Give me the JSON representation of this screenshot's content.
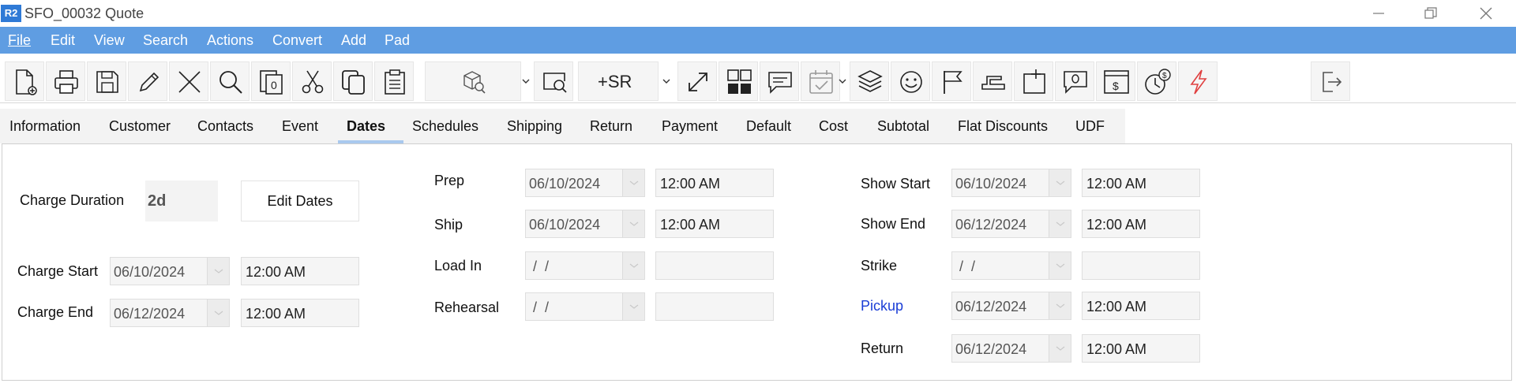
{
  "window": {
    "logo": "R2",
    "title": "SFO_00032 Quote"
  },
  "menu": [
    "File",
    "Edit",
    "View",
    "Search",
    "Actions",
    "Convert",
    "Add",
    "Pad"
  ],
  "toolbar": {
    "sr_label": "+SR",
    "icons": [
      "new-document-icon",
      "print-icon",
      "save-icon",
      "edit-pencil-icon",
      "delete-x-icon",
      "search-icon",
      "copy-number-icon",
      "cut-icon",
      "duplicate-icon",
      "paste-icon",
      "box-search-icon",
      "screen-search-icon",
      "expand-icon",
      "grid-icon",
      "comment-icon",
      "calendar-check-icon",
      "layers-icon",
      "smiley-icon",
      "flag-icon",
      "stapler-icon",
      "note-insert-icon",
      "message-icon",
      "invoice-icon",
      "time-money-icon",
      "lightning-icon",
      "exit-icon"
    ]
  },
  "tabs": [
    "Information",
    "Customer",
    "Contacts",
    "Event",
    "Dates",
    "Schedules",
    "Shipping",
    "Return",
    "Payment",
    "Default",
    "Cost",
    "Subtotal",
    "Flat Discounts",
    "UDF"
  ],
  "active_tab": "Dates",
  "dates": {
    "charge_duration_label": "Charge Duration",
    "charge_duration_value": "2d",
    "edit_dates_label": "Edit Dates",
    "charge_start": {
      "label": "Charge Start",
      "date": "06/10/2024",
      "time": "12:00 AM"
    },
    "charge_end": {
      "label": "Charge End",
      "date": "06/12/2024",
      "time": "12:00 AM"
    },
    "prep": {
      "label": "Prep",
      "date": "06/10/2024",
      "time": "12:00 AM"
    },
    "ship": {
      "label": "Ship",
      "date": "06/10/2024",
      "time": "12:00 AM"
    },
    "load_in": {
      "label": "Load In",
      "date": " /  /",
      "time": ""
    },
    "rehearsal": {
      "label": "Rehearsal",
      "date": " /  /",
      "time": ""
    },
    "show_start": {
      "label": "Show Start",
      "date": "06/10/2024",
      "time": "12:00 AM"
    },
    "show_end": {
      "label": "Show End",
      "date": "06/12/2024",
      "time": "12:00 AM"
    },
    "strike": {
      "label": "Strike",
      "date": " /  /",
      "time": ""
    },
    "pickup": {
      "label": "Pickup",
      "date": "06/12/2024",
      "time": "12:00 AM"
    },
    "return": {
      "label": "Return",
      "date": "06/12/2024",
      "time": "12:00 AM"
    }
  },
  "colors": {
    "menu_bar": "#5f9de2",
    "logo": "#2f7ad6",
    "link": "#1a3dd6",
    "lightning": "#e04040",
    "tab_underline": "#a9c9ee"
  }
}
